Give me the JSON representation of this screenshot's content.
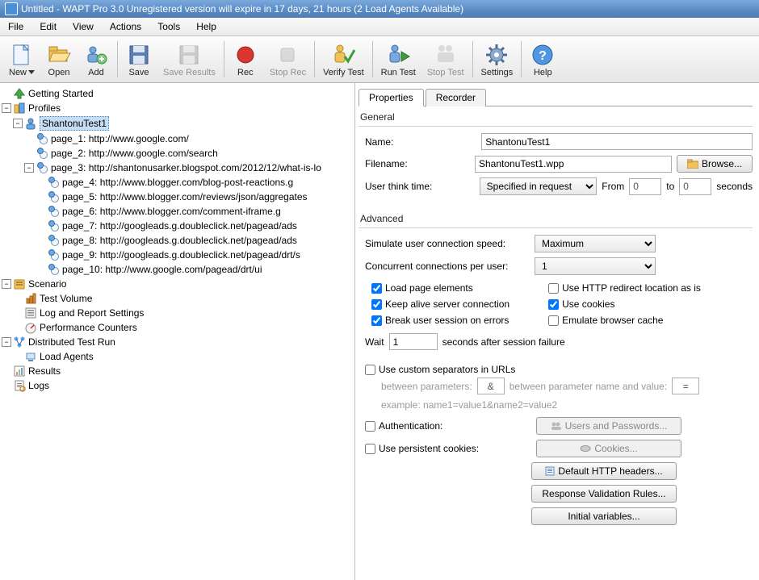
{
  "title": "Untitled - WAPT Pro 3.0 Unregistered version will expire in 17 days, 21 hours (2 Load Agents Available)",
  "menubar": [
    "File",
    "Edit",
    "View",
    "Actions",
    "Tools",
    "Help"
  ],
  "toolbar": [
    {
      "label": "New",
      "icon": "new",
      "disabled": false,
      "hasDrop": true
    },
    {
      "label": "Open",
      "icon": "open",
      "disabled": false
    },
    {
      "label": "Add",
      "icon": "add",
      "disabled": false
    },
    {
      "sep": true
    },
    {
      "label": "Save",
      "icon": "save",
      "disabled": false
    },
    {
      "label": "Save Results",
      "icon": "saveresults",
      "disabled": true
    },
    {
      "sep": true
    },
    {
      "label": "Rec",
      "icon": "rec",
      "disabled": false
    },
    {
      "label": "Stop Rec",
      "icon": "stoprec",
      "disabled": true
    },
    {
      "sep": true
    },
    {
      "label": "Verify Test",
      "icon": "verify",
      "disabled": false
    },
    {
      "sep": true
    },
    {
      "label": "Run Test",
      "icon": "run",
      "disabled": false
    },
    {
      "label": "Stop Test",
      "icon": "stoptest",
      "disabled": true
    },
    {
      "sep": true
    },
    {
      "label": "Settings",
      "icon": "settings",
      "disabled": false
    },
    {
      "sep": true
    },
    {
      "label": "Help",
      "icon": "help",
      "disabled": false
    }
  ],
  "tree": {
    "getting_started": "Getting Started",
    "profiles": "Profiles",
    "shantonu": "ShantonuTest1",
    "pages": [
      "page_1: http://www.google.com/",
      "page_2: http://www.google.com/search",
      "page_3: http://shantonusarker.blogspot.com/2012/12/what-is-lo",
      "page_4: http://www.blogger.com/blog-post-reactions.g",
      "page_5: http://www.blogger.com/reviews/json/aggregates",
      "page_6: http://www.blogger.com/comment-iframe.g",
      "page_7: http://googleads.g.doubleclick.net/pagead/ads",
      "page_8: http://googleads.g.doubleclick.net/pagead/ads",
      "page_9: http://googleads.g.doubleclick.net/pagead/drt/s",
      "page_10: http://www.google.com/pagead/drt/ui"
    ],
    "scenario": "Scenario",
    "test_volume": "Test Volume",
    "log_report": "Log and Report Settings",
    "perf_counters": "Performance Counters",
    "dist_test": "Distributed Test Run",
    "load_agents": "Load Agents",
    "results": "Results",
    "logs": "Logs"
  },
  "tabs": {
    "properties": "Properties",
    "recorder": "Recorder"
  },
  "general": {
    "heading": "General",
    "name_label": "Name:",
    "name_value": "ShantonuTest1",
    "filename_label": "Filename:",
    "filename_value": "ShantonuTest1.wpp",
    "browse": "Browse...",
    "think_label": "User think time:",
    "think_select": "Specified in request",
    "from": "From",
    "from_value": "0",
    "to": "to",
    "to_value": "0",
    "seconds": "seconds"
  },
  "advanced": {
    "heading": "Advanced",
    "sim_label": "Simulate user connection speed:",
    "sim_value": "Maximum",
    "conc_label": "Concurrent connections per user:",
    "conc_value": "1",
    "load_page": "Load page elements",
    "keep_alive": "Keep alive server connection",
    "break_session": "Break user session on errors",
    "http_redirect": "Use HTTP redirect location as is",
    "use_cookies": "Use cookies",
    "emulate_cache": "Emulate browser cache",
    "wait": "Wait",
    "wait_value": "1",
    "wait_after": "seconds after session failure",
    "custom_sep": "Use custom separators in URLs",
    "between_params": "between parameters:",
    "amp": "&",
    "between_name_value": "between parameter name and value:",
    "eq": "=",
    "example": "example: name1=value1&name2=value2",
    "auth": "Authentication:",
    "users_passwords": "Users and Passwords...",
    "persistent_cookies": "Use persistent cookies:",
    "cookies": "Cookies...",
    "default_headers": "Default HTTP headers...",
    "validation_rules": "Response Validation Rules...",
    "initial_vars": "Initial variables..."
  }
}
